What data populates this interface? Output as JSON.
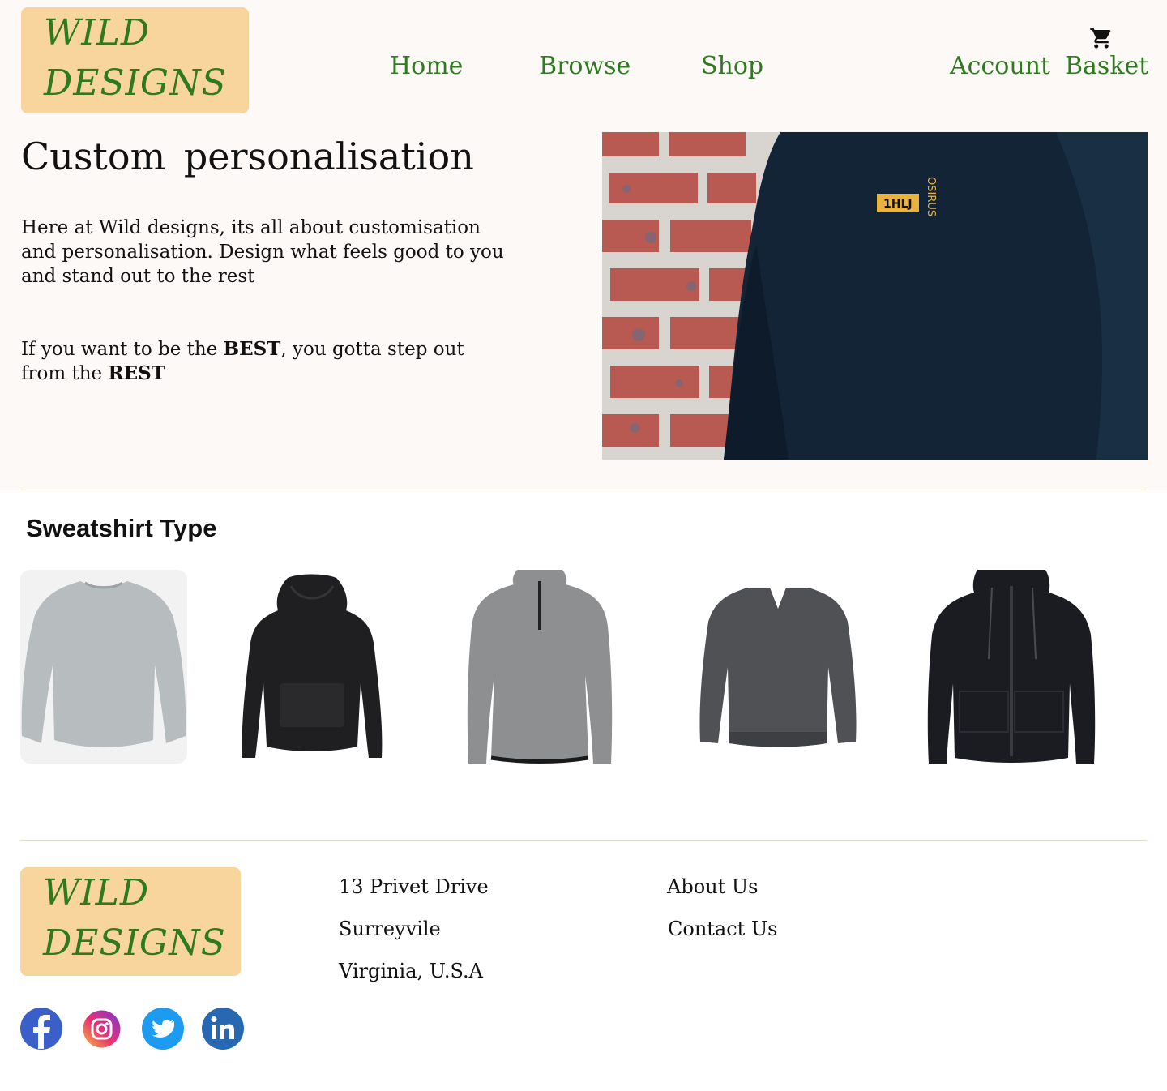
{
  "header": {
    "logo_line1": "WILD",
    "logo_line2": "DESIGNS",
    "nav": [
      "Home",
      "Browse",
      "Shop"
    ],
    "account_label": "Account",
    "basket_label": "Basket",
    "cart_icon": "shopping-cart-icon"
  },
  "hero": {
    "title": "Custom personalisation",
    "paragraph1": "Here at Wild designs, its all about customisation and personalisation. Design what feels good to you and stand out to the rest",
    "p2_part1": "If you want to be the ",
    "p2_bold1": "BEST",
    "p2_part2": ", you gotta step out from the ",
    "p2_bold2": "REST",
    "image_alt": "Navy sweatshirt against brick wall"
  },
  "sweatshirts": {
    "section_title": "Sweatshirt Type"
  },
  "footer": {
    "logo_line1": "WILD",
    "logo_line2": "DESIGNS",
    "address": [
      "13 Privet Drive",
      "Surreyvile",
      "Virginia, U.S.A"
    ],
    "links": [
      "About Us",
      "Contact Us"
    ],
    "social_icons": [
      "facebook-icon",
      "instagram-icon",
      "twitter-icon",
      "linkedin-icon"
    ]
  },
  "colors": {
    "brand_green": "#2f7a21",
    "logo_bg": "#f8d59c",
    "top_bg": "#fdf9f7"
  }
}
